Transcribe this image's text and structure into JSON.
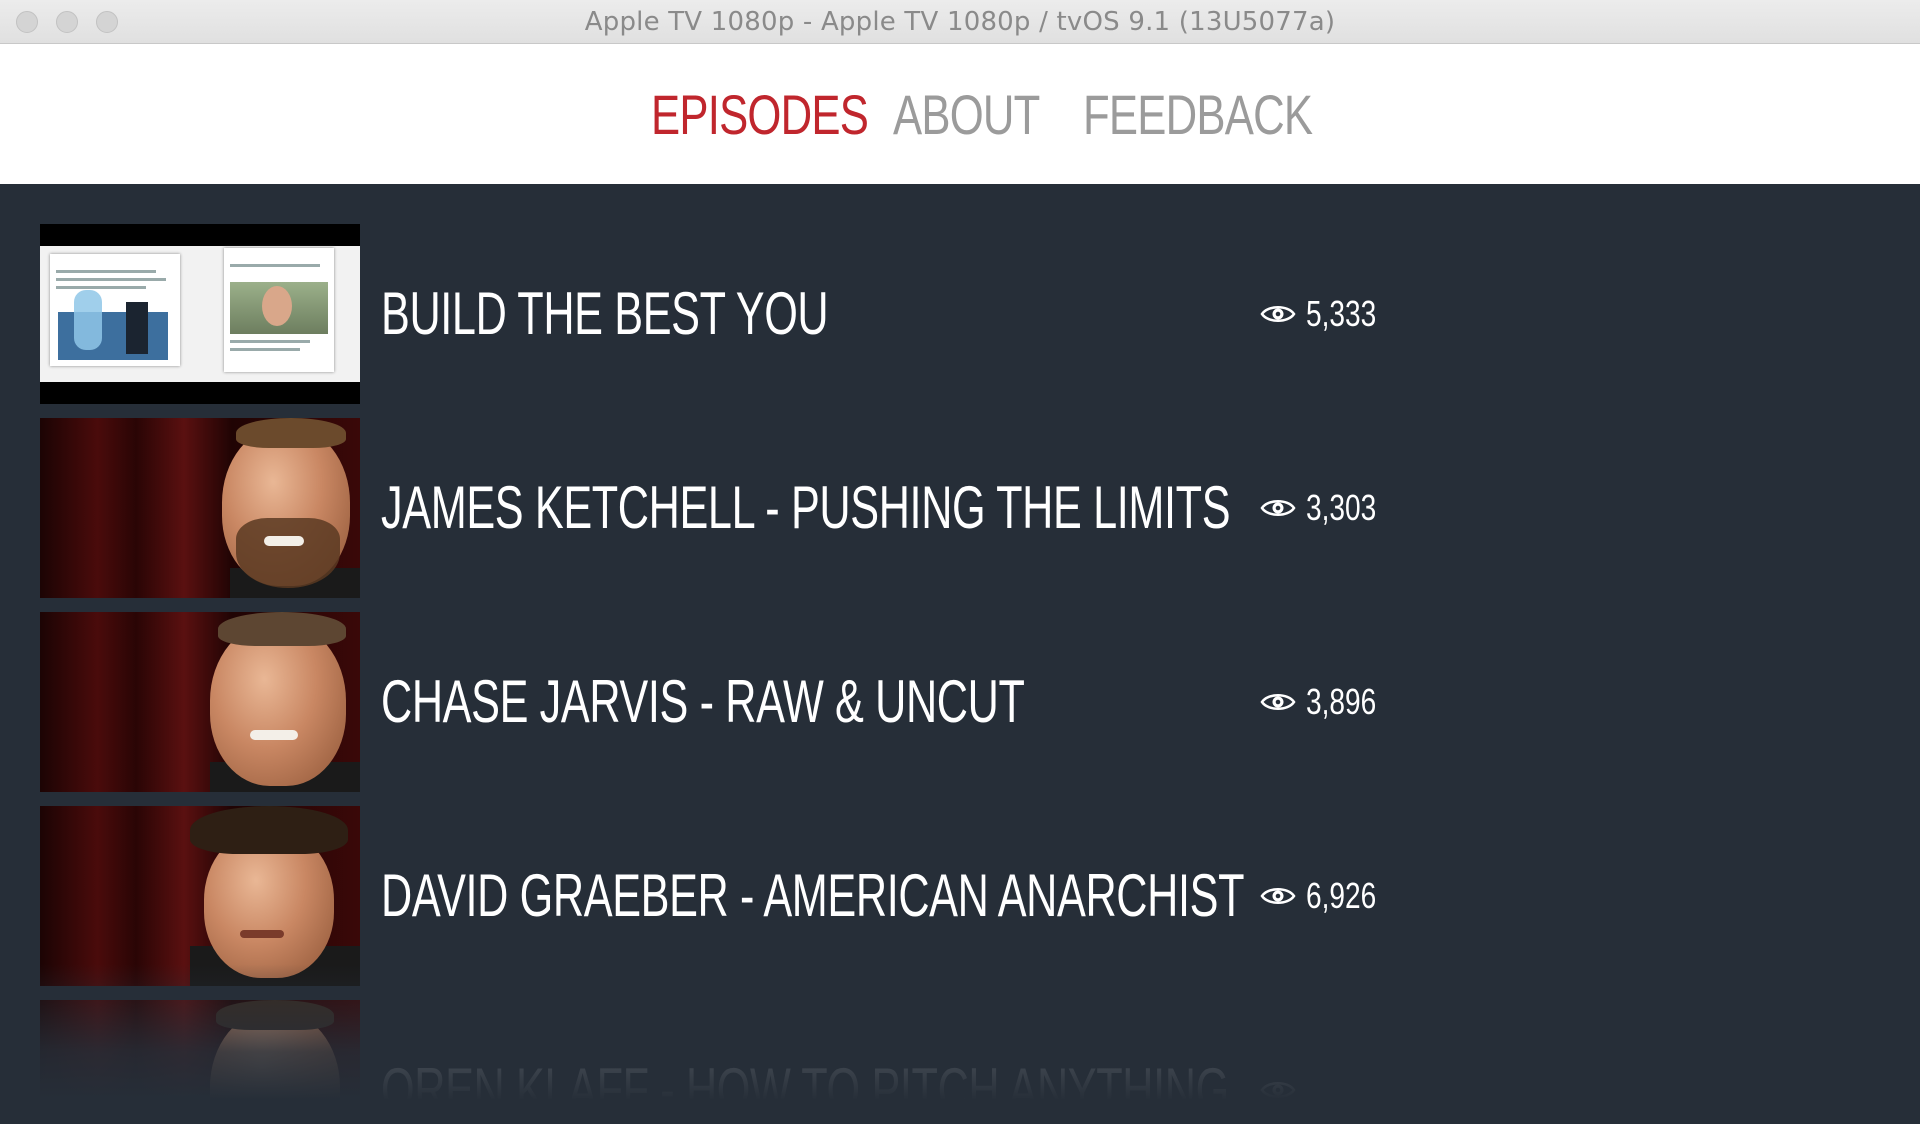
{
  "window": {
    "title": "Apple TV 1080p - Apple TV 1080p / tvOS 9.1 (13U5077a)"
  },
  "nav": {
    "tabs": [
      {
        "label": "EPISODES",
        "active": true
      },
      {
        "label": "ABOUT",
        "active": false
      },
      {
        "label": "FEEDBACK",
        "active": false
      }
    ]
  },
  "colors": {
    "accent": "#c0262d",
    "inactive_tab": "#9b9b9b",
    "list_background": "#262e38",
    "text": "#ffffff"
  },
  "episodes": [
    {
      "title": "BUILD THE BEST YOU",
      "views": "5,333",
      "icon": "eye-icon"
    },
    {
      "title": "JAMES KETCHELL - PUSHING THE LIMITS",
      "views": "3,303",
      "icon": "eye-icon"
    },
    {
      "title": "CHASE JARVIS - RAW & UNCUT",
      "views": "3,896",
      "icon": "eye-icon"
    },
    {
      "title": "DAVID GRAEBER - AMERICAN ANARCHIST",
      "views": "6,926",
      "icon": "eye-icon"
    },
    {
      "title": "OREN KLAFF - HOW TO PITCH ANYTHING",
      "views": "",
      "icon": "eye-icon"
    }
  ]
}
